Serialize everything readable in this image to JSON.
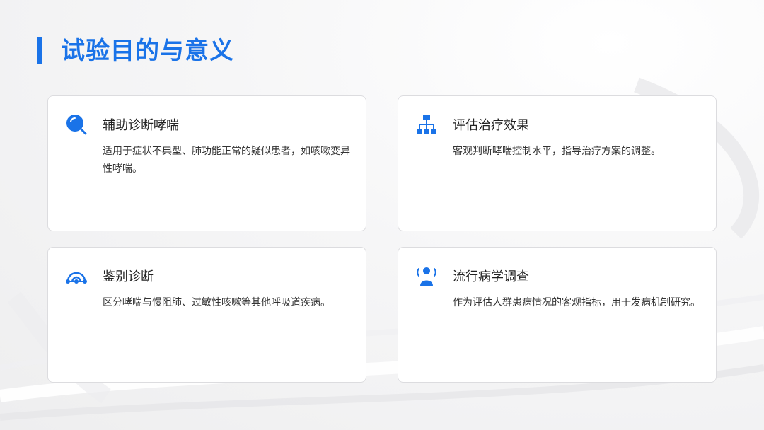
{
  "page": {
    "title": "试验目的与意义",
    "accent_color": "#1a73e8"
  },
  "cards": [
    {
      "icon": "search-icon",
      "title": "辅助诊断哮喘",
      "description": "适用于症状不典型、肺功能正常的疑似患者，如咳嗽变异性哮喘。"
    },
    {
      "icon": "hierarchy-icon",
      "title": "评估治疗效果",
      "description": "客观判断哮喘控制水平，指导治疗方案的调整。"
    },
    {
      "icon": "network-arc-icon",
      "title": "鉴别诊断",
      "description": "区分哮喘与慢阻肺、过敏性咳嗽等其他呼吸道疾病。"
    },
    {
      "icon": "people-group-icon",
      "title": "流行病学调查",
      "description": "作为评估人群患病情况的客观指标，用于发病机制研究。"
    }
  ]
}
